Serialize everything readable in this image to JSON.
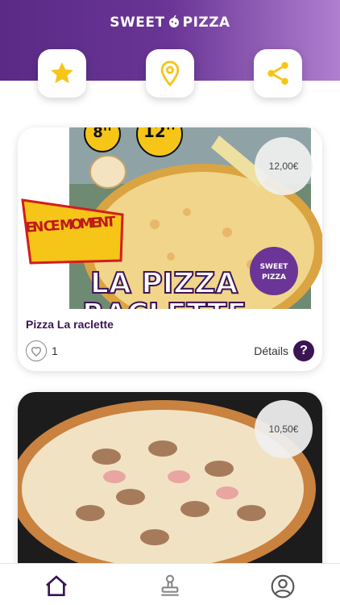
{
  "app": {
    "logo_text_left": "SWEET",
    "logo_text_right": "PIZZA"
  },
  "header_actions": [
    {
      "icon": "star-icon",
      "color": "#f5c518"
    },
    {
      "icon": "location-pin-icon",
      "color": "#f5c518"
    },
    {
      "icon": "share-icon",
      "color": "#f5c518"
    }
  ],
  "products": [
    {
      "price": "12,00€",
      "title": "Pizza La raclette",
      "likes": "1",
      "details_label": "Détails",
      "details_icon": "?",
      "promo_banner": "EN CE MOMENT",
      "promo_title_line1": "LA PIZZA",
      "promo_title_line2": "RACLETTE",
      "promo_numbers": [
        "8''",
        "12''"
      ],
      "promo_brand_left": "SWEET",
      "promo_brand_right": "PIZZA"
    },
    {
      "price": "10,50€"
    }
  ],
  "bottom_nav": [
    {
      "icon": "home-icon",
      "active": true
    },
    {
      "icon": "stamp-icon",
      "active": false
    },
    {
      "icon": "user-account-icon",
      "active": false
    }
  ],
  "colors": {
    "brand_purple": "#5a2a86",
    "accent_yellow": "#f5c518",
    "dark_purple": "#3b1454"
  }
}
